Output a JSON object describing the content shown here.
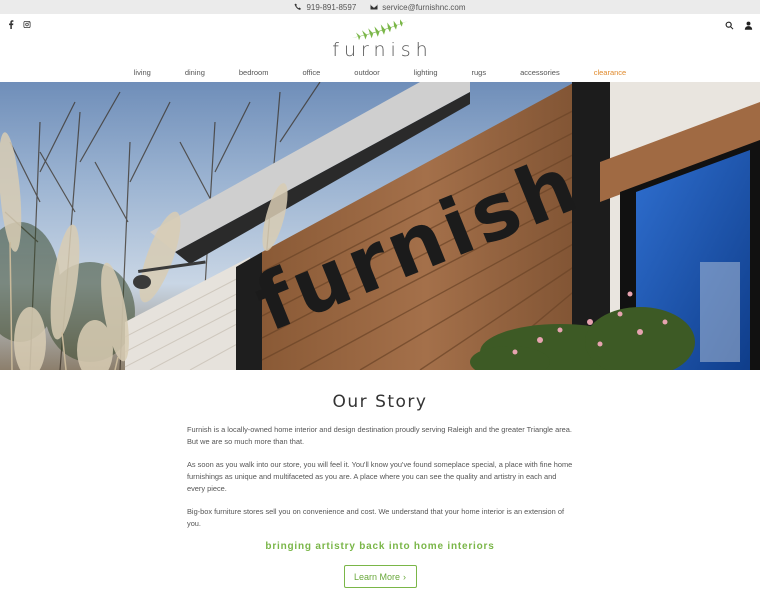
{
  "topbar": {
    "phone": "919-891-8597",
    "email": "service@furnishnc.com"
  },
  "header": {
    "logo_text": "furnish",
    "social_icons": [
      "facebook-icon",
      "instagram-icon"
    ],
    "tool_icons": [
      "search-icon",
      "user-icon"
    ]
  },
  "nav": {
    "items": [
      {
        "label": "living"
      },
      {
        "label": "dining"
      },
      {
        "label": "bedroom"
      },
      {
        "label": "office"
      },
      {
        "label": "outdoor"
      },
      {
        "label": "lighting"
      },
      {
        "label": "rugs"
      },
      {
        "label": "accessories"
      },
      {
        "label": "clearance"
      }
    ]
  },
  "hero": {
    "sign_text": "furnish"
  },
  "story": {
    "title": "Our Story",
    "paragraphs": [
      "Furnish is a locally-owned home interior and design destination proudly serving Raleigh and the greater Triangle area. But we are so much more than that.",
      "As soon as you walk into our store, you will feel it. You'll know you've found someplace special, a place with fine home furnishings as unique and multifaceted as you are. A place where you can see the quality and artistry in each and every piece.",
      "Big-box furniture stores sell you on convenience and cost. We understand that your home interior is an extension of you."
    ],
    "tagline": "bringing artistry back into home interiors",
    "button_label": "Learn More"
  },
  "colors": {
    "accent_green": "#7ab648",
    "clearance_orange": "#e08a2c"
  }
}
